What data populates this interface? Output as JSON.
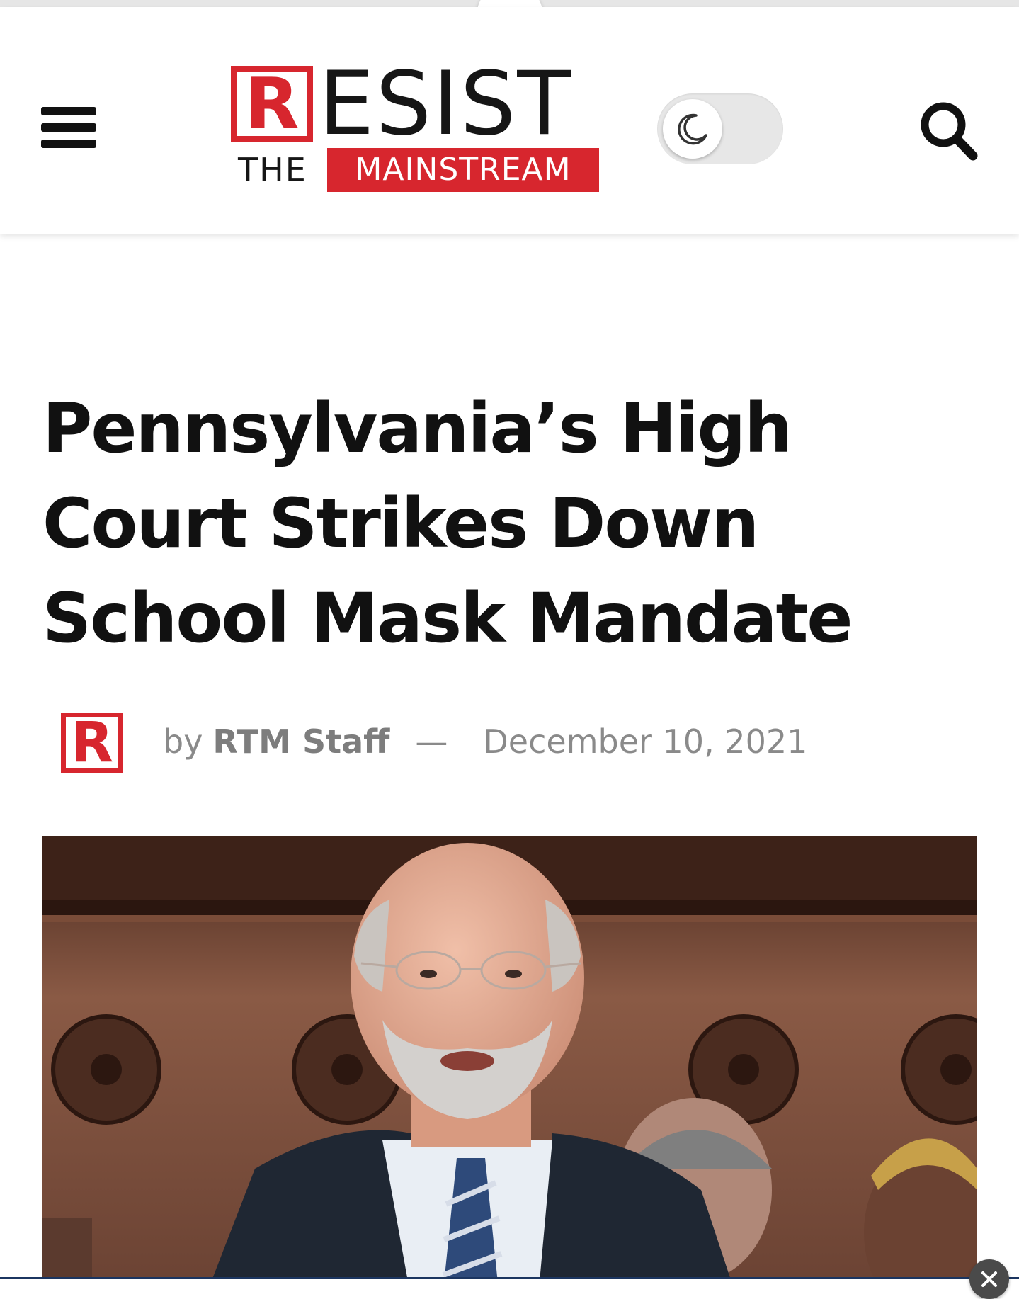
{
  "header": {
    "menu_icon": "hamburger-menu-icon",
    "logo": {
      "r_letter": "R",
      "esist": "ESIST",
      "the": "THE",
      "mainstream": "MAINSTREAM"
    },
    "dark_mode_icon": "moon-icon",
    "search_icon": "search-icon"
  },
  "article": {
    "title": "Pennsylvania’s High Court Strikes Down School Mask Mandate",
    "author_avatar_letter": "R",
    "by": "by",
    "author": "RTM Staff",
    "separator": "—",
    "date": "December 10, 2021"
  },
  "colors": {
    "brand_red": "#d7262e",
    "text_dark": "#111111",
    "meta_gray": "#8a8a8a",
    "bottom_bar_border": "#1b3560"
  },
  "overlay": {
    "close_icon": "close-x-icon"
  }
}
